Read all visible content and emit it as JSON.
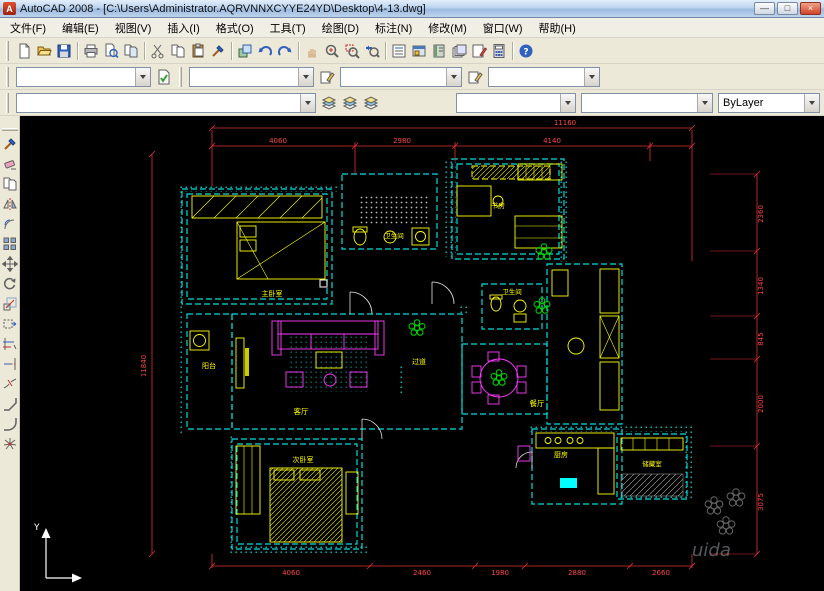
{
  "window": {
    "icon_letter": "A",
    "title": "AutoCAD 2008 - [C:\\Users\\Administrator.AQRVNNXCYYE24YD\\Desktop\\4-13.dwg]",
    "buttons": {
      "minimize": "—",
      "maximize": "□",
      "close": "×"
    }
  },
  "menu": [
    "文件(F)",
    "编辑(E)",
    "视图(V)",
    "插入(I)",
    "格式(O)",
    "工具(T)",
    "绘图(D)",
    "标注(N)",
    "修改(M)",
    "窗口(W)",
    "帮助(H)"
  ],
  "toolbars": {
    "standard": [
      "new",
      "open",
      "save",
      "plot",
      "plot-preview",
      "publish",
      "cut",
      "copy",
      "paste",
      "match-properties",
      "block-editor",
      "undo",
      "redo",
      "pan",
      "zoom-realtime",
      "zoom-window",
      "zoom-previous",
      "properties",
      "designcenter",
      "tool-palettes",
      "sheetset",
      "markup",
      "quickcalc",
      "help"
    ],
    "modify": [
      "match-properties",
      "erase",
      "copy",
      "mirror",
      "offset",
      "array",
      "move",
      "rotate",
      "scale",
      "stretch",
      "trim",
      "extend",
      "break",
      "chamfer",
      "fillet",
      "explode"
    ],
    "combos": {
      "workspace": "",
      "text_style": "",
      "dim_style": "",
      "table_style": "",
      "layer": "",
      "color": "",
      "linetype": "",
      "lineweight": "ByLayer"
    }
  },
  "plan": {
    "rooms": {
      "master": "主卧室",
      "bath1": "卫生间",
      "study": "书房",
      "bath2": "卫生间",
      "balcony": "阳台",
      "living": "客厅",
      "hallway": "过道",
      "dining": "餐厅",
      "bedroom2": "次卧室",
      "kitchen": "厨房",
      "storage": "储藏室"
    },
    "dims": {
      "top_overall": "11160",
      "top": [
        "4060",
        "2980",
        "4140"
      ],
      "left": "11840",
      "right": [
        "2360",
        "1340",
        "845",
        "2000",
        "3075"
      ],
      "bottom": [
        "4060",
        "2460",
        "1980",
        "2880",
        "2660"
      ]
    },
    "ucs_y": "Y",
    "watermark": "uida"
  },
  "colors": {
    "wall": "#00dcdc",
    "furniture": "#ffff00",
    "decor": "#ff3cff",
    "plant": "#00d800",
    "dimension": "#ff4444",
    "canvas": "#000000"
  }
}
